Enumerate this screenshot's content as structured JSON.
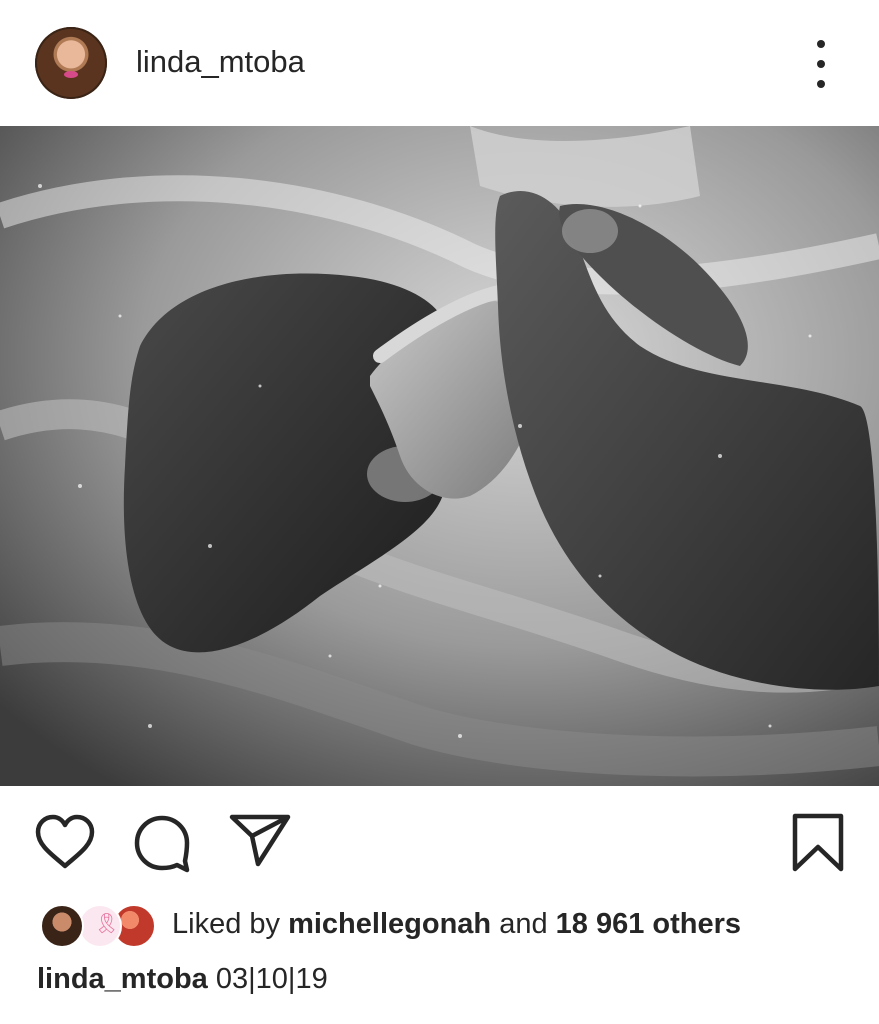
{
  "post": {
    "username": "linda_mtoba",
    "more_icon": "more-vertical-icon"
  },
  "photo": {
    "alt_semantic": "post-photo",
    "tone": "black-and-white"
  },
  "actions": {
    "like_icon": "heart-icon",
    "comment_icon": "comment-icon",
    "share_icon": "send-icon",
    "save_icon": "bookmark-icon"
  },
  "likes": {
    "prefix": "Liked by",
    "first_liker": "michellegonah",
    "connector": "and",
    "others_count": "18 961 others"
  },
  "caption": {
    "username": "linda_mtoba",
    "text": "03|10|19"
  },
  "colors": {
    "text": "#262626",
    "background": "#ffffff"
  }
}
